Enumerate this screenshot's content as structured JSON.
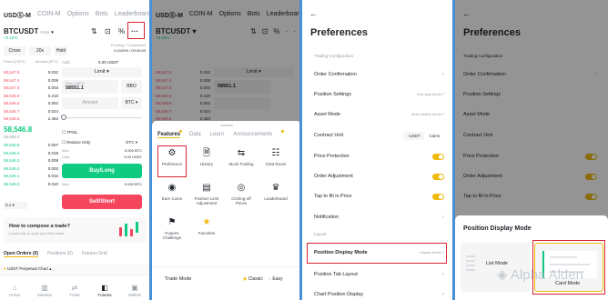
{
  "screen1": {
    "tabs": [
      "USDⓈ-M",
      "COIN-M",
      "Options",
      "Bots",
      "Leaderboard"
    ],
    "symbol": "BTCUSDT",
    "symbol_suffix": "Perp",
    "change": "+0.16%",
    "funding_label": "Funding / Countdown",
    "funding_value": "0.0100% / 00:49:53",
    "margin_mode": "Cross",
    "leverage": "20x",
    "side": "Hold",
    "book_header_left": "Price (USDT)",
    "book_header_right": "Amount (BTC)",
    "asks": [
      {
        "price": "58,547.5",
        "amt": "0.032"
      },
      {
        "price": "58,547.4",
        "amt": "0.008"
      },
      {
        "price": "58,547.0",
        "amt": "0.003"
      },
      {
        "price": "58,546.9",
        "amt": "0.210"
      },
      {
        "price": "58,546.8",
        "amt": "0.052"
      },
      {
        "price": "58,546.7",
        "amt": "0.024"
      },
      {
        "price": "58,546.6",
        "amt": "2.453"
      }
    ],
    "avbl_label": "Avbl",
    "avbl_value": "0.00 USDT",
    "order_type": "Limit",
    "price_label": "Price (USDT)",
    "price_value": "58551.1",
    "bbo": "BBO",
    "amount_placeholder": "Amount",
    "amount_unit": "BTC",
    "tpsl_label": "TP/SL",
    "reduce_only": "Reduce Only",
    "gtc": "GTC",
    "max_label": "Max",
    "max_value": "0.000 BTC",
    "cost_label": "Cost",
    "cost_value": "0.00 USDT",
    "mark_price": "58,546.8",
    "mark_price_sub": "58,556.2",
    "bids": [
      {
        "price": "58,546.5",
        "amt": "0.007"
      },
      {
        "price": "58,546.4",
        "amt": "0.018"
      },
      {
        "price": "58,546.3",
        "amt": "0.008"
      },
      {
        "price": "58,546.2",
        "amt": "0.003"
      },
      {
        "price": "58,546.1",
        "amt": "0.015"
      },
      {
        "price": "58,546.0",
        "amt": "0.010"
      }
    ],
    "buy_label": "Buy/Long",
    "sell_label": "Sell/Short",
    "book_step": "0.1",
    "promo_title": "How to compose a trade?",
    "promo_sub": "Learn how to open your first order",
    "orders_tabs": [
      "Open Orders (0)",
      "Positions (0)",
      "Futures Grid"
    ],
    "perp_chart": "USDT Perpetual Chart",
    "nav": [
      "Home",
      "Markets",
      "Trade",
      "Futures",
      "Wallets"
    ]
  },
  "screen2": {
    "menu_tabs": [
      "Features",
      "Data",
      "Learn",
      "Announcements"
    ],
    "features": [
      {
        "label": "Preference",
        "icon": "gear-icon",
        "glyph": "⚙"
      },
      {
        "label": "History",
        "icon": "history-icon",
        "glyph": "🗎"
      },
      {
        "label": "Mock Trading",
        "icon": "mock-trading-icon",
        "glyph": "⇆"
      },
      {
        "label": "Chat Room",
        "icon": "chat-icon",
        "glyph": "☷"
      },
      {
        "label": "Earn Coins",
        "icon": "earn-coins-icon",
        "glyph": "◉"
      },
      {
        "label": "Position Limit Adjustment",
        "icon": "position-limit-icon",
        "glyph": "▤"
      },
      {
        "label": "Circling-off Prices",
        "icon": "circling-icon",
        "glyph": "◎"
      },
      {
        "label": "Leaderboard",
        "icon": "leaderboard-icon",
        "glyph": "♛"
      },
      {
        "label": "Futures Challenge",
        "icon": "challenge-icon",
        "glyph": "⚑"
      },
      {
        "label": "Favorites",
        "icon": "star-icon",
        "glyph": "★"
      }
    ],
    "trade_mode_label": "Trade Mode",
    "trade_mode_options": [
      "Classic",
      "Easy"
    ]
  },
  "preferences": {
    "back": "←",
    "title": "Preferences",
    "section_trading": "Trading Configuration",
    "items": [
      {
        "label": "Order Confirmation",
        "value": ""
      },
      {
        "label": "Position Settings",
        "value": "One-way Mode"
      },
      {
        "label": "Asset Mode",
        "value": "Multi-Assets Mode"
      },
      {
        "label": "Contract Unit",
        "value": ""
      }
    ],
    "unit_options": [
      "USDT",
      "Coins"
    ],
    "toggles": [
      "Price Protection",
      "Order Adjustment",
      "Tap to fill in Price"
    ],
    "notification": "Notification",
    "section_layout": "Layout",
    "position_display_mode": "Position Display Mode",
    "position_display_value": "Classic Mode",
    "position_tab_layout": "Position Tab Layout",
    "bottom_item": "Chart Position Display"
  },
  "screen4": {
    "sheet_title": "Position Display Mode",
    "option_list": "List Mode",
    "option_card": "Card Mode"
  },
  "watermark": "Alpha Alden",
  "colors": {
    "green": "#0ecb81",
    "red": "#f6465d",
    "yellow": "#f0b90b",
    "highlight": "#d9232d"
  }
}
